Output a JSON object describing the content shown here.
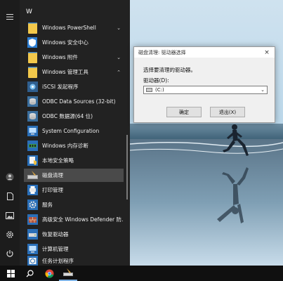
{
  "start_menu": {
    "letter": "W",
    "apps": [
      {
        "label": "Windows PowerShell",
        "expand": "⌄"
      },
      {
        "label": "Windows 安全中心",
        "expand": ""
      },
      {
        "label": "Windows 附件",
        "expand": "⌄"
      },
      {
        "label": "Windows 管理工具",
        "expand": "⌃"
      },
      {
        "label": "iSCSI 发起程序",
        "expand": ""
      },
      {
        "label": "ODBC Data Sources (32-bit)",
        "expand": ""
      },
      {
        "label": "ODBC 数据源(64 位)",
        "expand": ""
      },
      {
        "label": "System Configuration",
        "expand": ""
      },
      {
        "label": "Windows 内存诊断",
        "expand": ""
      },
      {
        "label": "本地安全策略",
        "expand": ""
      },
      {
        "label": "磁盘清理",
        "expand": ""
      },
      {
        "label": "打印管理",
        "expand": ""
      },
      {
        "label": "服务",
        "expand": ""
      },
      {
        "label": "高级安全 Windows Defender 防...",
        "expand": ""
      },
      {
        "label": "恢复驱动器",
        "expand": ""
      },
      {
        "label": "计算机管理",
        "expand": ""
      },
      {
        "label": "任务计划程序",
        "expand": ""
      }
    ],
    "rail_icons": [
      "hamburger-icon",
      "user-icon",
      "document-icon",
      "pictures-icon",
      "settings-icon",
      "power-icon"
    ]
  },
  "dialog": {
    "title": "磁盘清理: 驱动器选择",
    "close": "×",
    "prompt": "选择要清理的驱动器。",
    "drive_label": "驱动器(D):",
    "drive_value": "(C:)",
    "ok": "确定",
    "exit": "退出(X)"
  },
  "taskbar": {
    "items": [
      "windows-start",
      "search",
      "chrome",
      "disk-cleanup"
    ]
  }
}
